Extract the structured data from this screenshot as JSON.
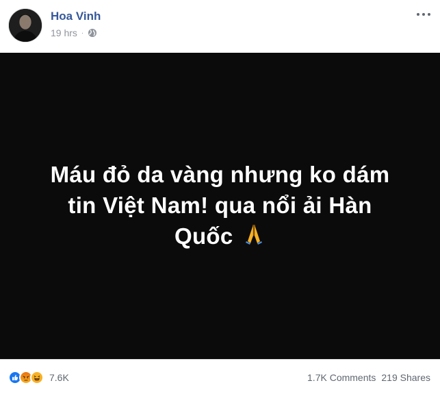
{
  "post": {
    "author": "Hoa Vinh",
    "time": "19 hrs",
    "separator": "·",
    "privacy_icon": "globe-icon",
    "text_line1": "Máu đỏ da vàng nhưng ko dám",
    "text_line2": "tin Việt Nam! qua nổi ải Hàn",
    "text_line3": "Quốc",
    "text_emoji": "folded-hands-emoji"
  },
  "footer": {
    "reaction_icons": [
      "like-icon",
      "angry-icon",
      "haha-icon"
    ],
    "reaction_count": "7.6K",
    "comments": "1.7K Comments",
    "shares": "219 Shares"
  },
  "colors": {
    "author_link": "#365899",
    "meta_text": "#90949c",
    "post_bg": "#0b0b0b",
    "like_blue": "#1877f2",
    "angry_red": "#e9710f",
    "haha_yellow": "#f7b125"
  }
}
